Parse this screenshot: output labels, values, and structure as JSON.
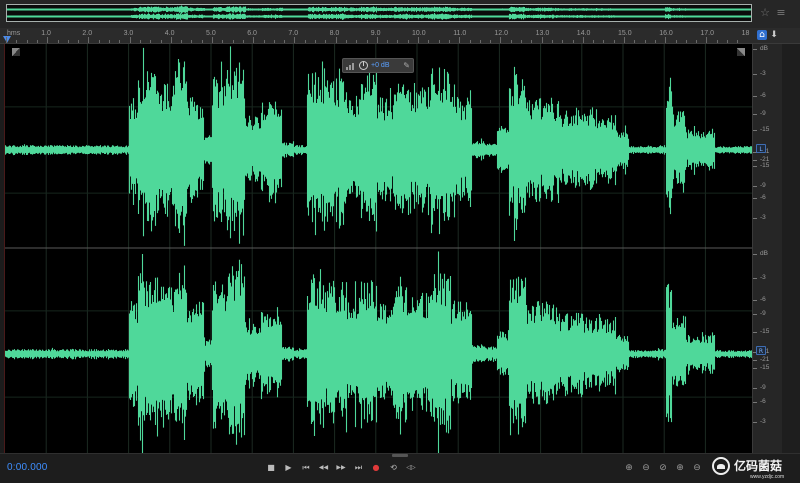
{
  "ruler": {
    "unit": "hms",
    "ticks": [
      "1.0",
      "2.0",
      "3.0",
      "4.0",
      "5.0",
      "6.0",
      "7.0",
      "8.0",
      "9.0",
      "10.0",
      "11.0",
      "12.0",
      "13.0",
      "14.0",
      "15.0",
      "16.0",
      "17.0",
      "18"
    ]
  },
  "hud": {
    "gain_value": "+0 dB"
  },
  "db_scale": {
    "unit": "dB",
    "left_channel": [
      "-3",
      "-6",
      "-9",
      "-15",
      "-21",
      "-21",
      "-15",
      "-9",
      "-6",
      "-3"
    ],
    "right_channel": [
      "-3",
      "-6",
      "-9",
      "-15",
      "-21",
      "-21",
      "-15",
      "-9",
      "-6",
      "-3"
    ],
    "channel_left": "L",
    "channel_right": "R"
  },
  "transport": {
    "time": "0:00.000",
    "buttons": [
      {
        "name": "stop-button",
        "glyph": "■"
      },
      {
        "name": "play-button",
        "glyph": "▶"
      },
      {
        "name": "move-to-previous-button",
        "glyph": "⏮"
      },
      {
        "name": "rewind-button",
        "glyph": "◀◀"
      },
      {
        "name": "fast-forward-button",
        "glyph": "▶▶"
      },
      {
        "name": "move-to-next-button",
        "glyph": "⏭"
      },
      {
        "name": "record-button",
        "glyph": "●"
      },
      {
        "name": "loop-playback-button",
        "glyph": "⟲"
      },
      {
        "name": "skip-selection-button",
        "glyph": "◁▷"
      }
    ],
    "zoom_buttons": [
      {
        "name": "zoom-in-amplitude-icon",
        "glyph": "⊕"
      },
      {
        "name": "zoom-out-amplitude-icon",
        "glyph": "⊖"
      },
      {
        "name": "zoom-out-full-icon",
        "glyph": "⊘"
      },
      {
        "name": "zoom-in-time-icon",
        "glyph": "⊕"
      },
      {
        "name": "zoom-out-time-icon",
        "glyph": "⊖"
      }
    ]
  },
  "watermark": {
    "text": "亿码菌菇",
    "url": "www.yzdjc.com"
  },
  "colors": {
    "waveform": "#4fd89a",
    "background": "#000000",
    "accent": "#3f8fff",
    "record": "#e03a3a"
  }
}
